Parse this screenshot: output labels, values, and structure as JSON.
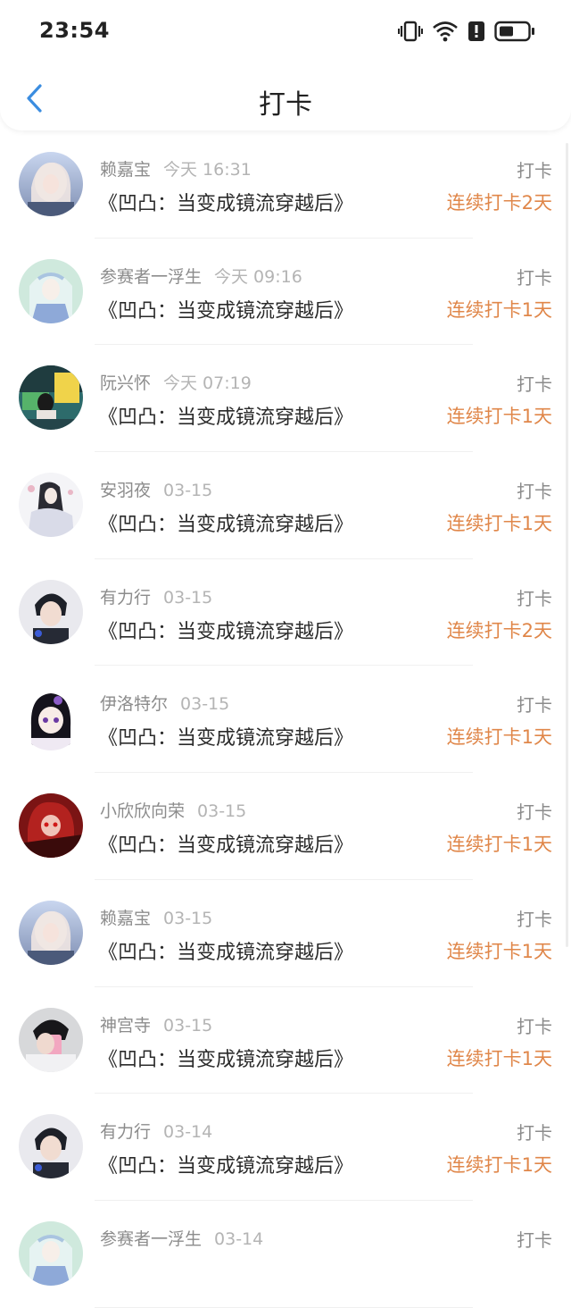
{
  "status_bar": {
    "time": "23:54"
  },
  "header": {
    "title": "打卡",
    "back_icon": "chevron-left-icon"
  },
  "colors": {
    "accent": "#e0874a",
    "back": "#3b8de0"
  },
  "list": [
    {
      "name": "赖嘉宝",
      "date": "今天 16:31",
      "book": "《凹凸：当变成镜流穿越后》",
      "tag": "打卡",
      "streak": "连续打卡2天",
      "avatar": "a1"
    },
    {
      "name": "参赛者一浮生",
      "date": "今天 09:16",
      "book": "《凹凸：当变成镜流穿越后》",
      "tag": "打卡",
      "streak": "连续打卡1天",
      "avatar": "a2"
    },
    {
      "name": "阮兴怀",
      "date": "今天 07:19",
      "book": "《凹凸：当变成镜流穿越后》",
      "tag": "打卡",
      "streak": "连续打卡1天",
      "avatar": "a3"
    },
    {
      "name": "安羽夜",
      "date": "03-15",
      "book": "《凹凸：当变成镜流穿越后》",
      "tag": "打卡",
      "streak": "连续打卡1天",
      "avatar": "a4"
    },
    {
      "name": "有力行",
      "date": "03-15",
      "book": "《凹凸：当变成镜流穿越后》",
      "tag": "打卡",
      "streak": "连续打卡2天",
      "avatar": "a5"
    },
    {
      "name": "伊洛特尔",
      "date": "03-15",
      "book": "《凹凸：当变成镜流穿越后》",
      "tag": "打卡",
      "streak": "连续打卡1天",
      "avatar": "a6"
    },
    {
      "name": "小欣欣向荣",
      "date": "03-15",
      "book": "《凹凸：当变成镜流穿越后》",
      "tag": "打卡",
      "streak": "连续打卡1天",
      "avatar": "a7"
    },
    {
      "name": "赖嘉宝",
      "date": "03-15",
      "book": "《凹凸：当变成镜流穿越后》",
      "tag": "打卡",
      "streak": "连续打卡1天",
      "avatar": "a1"
    },
    {
      "name": "神宫寺",
      "date": "03-15",
      "book": "《凹凸：当变成镜流穿越后》",
      "tag": "打卡",
      "streak": "连续打卡1天",
      "avatar": "a8"
    },
    {
      "name": "有力行",
      "date": "03-14",
      "book": "《凹凸：当变成镜流穿越后》",
      "tag": "打卡",
      "streak": "连续打卡1天",
      "avatar": "a5"
    },
    {
      "name": "参赛者一浮生",
      "date": "03-14",
      "book": "",
      "tag": "打卡",
      "streak": "",
      "avatar": "a2"
    }
  ]
}
